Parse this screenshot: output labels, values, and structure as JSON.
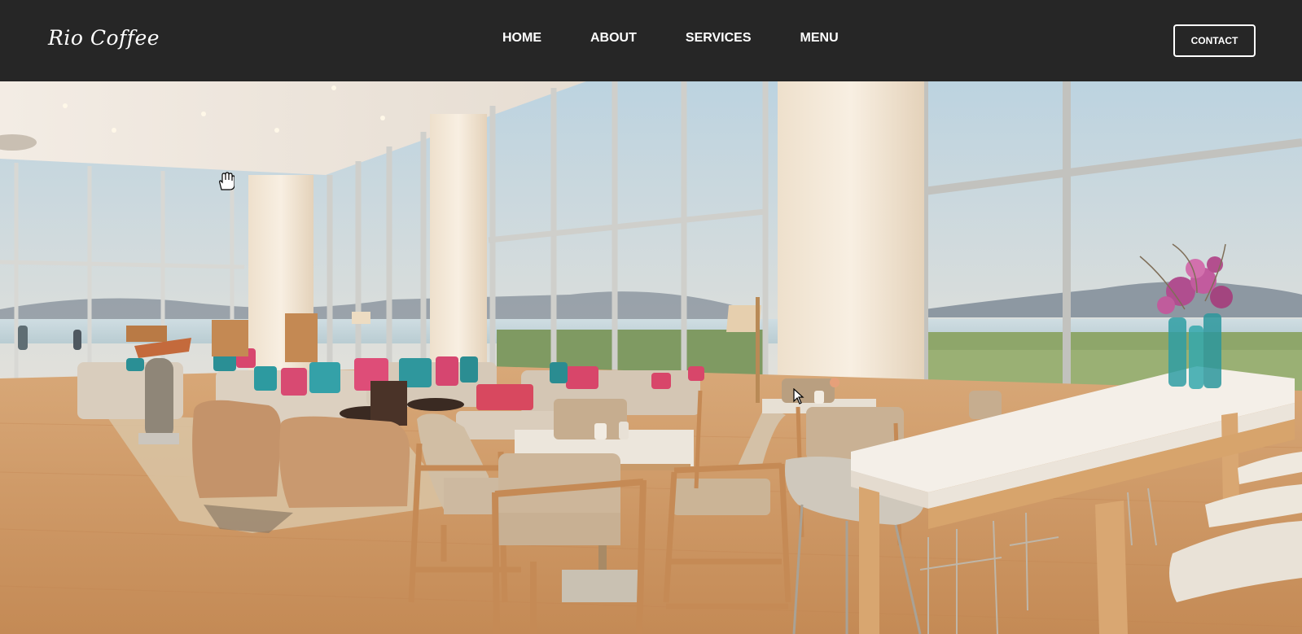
{
  "navbar": {
    "brand": "Rio Coffee",
    "links": [
      {
        "label": "HOME"
      },
      {
        "label": "ABOUT"
      },
      {
        "label": "SERVICES"
      },
      {
        "label": "MENU"
      }
    ],
    "contact_label": "CONTACT",
    "background_color": "#262626"
  },
  "hero": {
    "image_icon": "cafe-lounge-photo",
    "cursor_icons": [
      "hand-cursor-icon",
      "arrow-cursor-icon"
    ]
  }
}
